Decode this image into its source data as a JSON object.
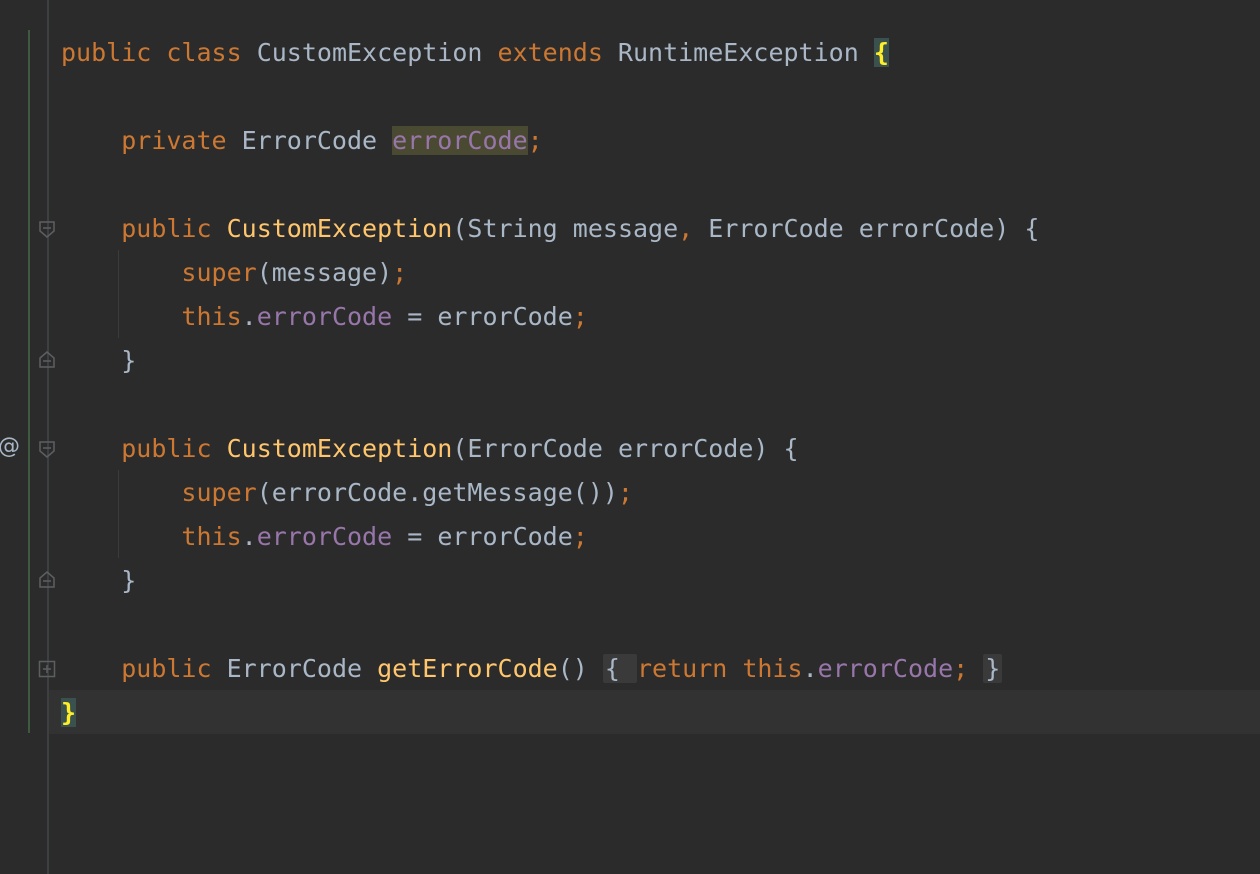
{
  "editor": {
    "gutter": {
      "override_marker": "@"
    },
    "lines": [
      [
        {
          "t": "public",
          "c": "kw"
        },
        {
          "t": " "
        },
        {
          "t": "class",
          "c": "kw"
        },
        {
          "t": " CustomException "
        },
        {
          "t": "extends",
          "c": "kw"
        },
        {
          "t": " RuntimeException "
        },
        {
          "t": "{",
          "c": "brace-match"
        }
      ],
      [],
      [
        {
          "t": "    "
        },
        {
          "t": "private",
          "c": "kw"
        },
        {
          "t": " ErrorCode "
        },
        {
          "t": "errorCode",
          "c": "fld field-highlight"
        },
        {
          "t": ";",
          "c": "kw"
        }
      ],
      [],
      [
        {
          "t": "    "
        },
        {
          "t": "public",
          "c": "kw"
        },
        {
          "t": " "
        },
        {
          "t": "CustomException",
          "c": "fn"
        },
        {
          "t": "(String message"
        },
        {
          "t": ",",
          "c": "kw"
        },
        {
          "t": " ErrorCode errorCode) {"
        }
      ],
      [
        {
          "t": "        "
        },
        {
          "t": "super",
          "c": "kw"
        },
        {
          "t": "(message)"
        },
        {
          "t": ";",
          "c": "kw"
        }
      ],
      [
        {
          "t": "        "
        },
        {
          "t": "this",
          "c": "kw"
        },
        {
          "t": "."
        },
        {
          "t": "errorCode",
          "c": "fld"
        },
        {
          "t": " = errorCode"
        },
        {
          "t": ";",
          "c": "kw"
        }
      ],
      [
        {
          "t": "    }"
        }
      ],
      [],
      [
        {
          "t": "    "
        },
        {
          "t": "public",
          "c": "kw"
        },
        {
          "t": " "
        },
        {
          "t": "CustomException",
          "c": "fn"
        },
        {
          "t": "(ErrorCode errorCode) {"
        }
      ],
      [
        {
          "t": "        "
        },
        {
          "t": "super",
          "c": "kw"
        },
        {
          "t": "(errorCode.getMessage())"
        },
        {
          "t": ";",
          "c": "kw"
        }
      ],
      [
        {
          "t": "        "
        },
        {
          "t": "this",
          "c": "kw"
        },
        {
          "t": "."
        },
        {
          "t": "errorCode",
          "c": "fld"
        },
        {
          "t": " = errorCode"
        },
        {
          "t": ";",
          "c": "kw"
        }
      ],
      [
        {
          "t": "    }"
        }
      ],
      [],
      [
        {
          "t": "    "
        },
        {
          "t": "public",
          "c": "kw"
        },
        {
          "t": " ErrorCode "
        },
        {
          "t": "getErrorCode",
          "c": "fn"
        },
        {
          "t": "() "
        },
        {
          "t": "{ ",
          "c": "fold-box"
        },
        {
          "t": "return",
          "c": "kw"
        },
        {
          "t": " "
        },
        {
          "t": "this",
          "c": "kw"
        },
        {
          "t": "."
        },
        {
          "t": "errorCode",
          "c": "fld"
        },
        {
          "t": ";",
          "c": "kw"
        },
        {
          "t": " "
        },
        {
          "t": "}",
          "c": "fold-box"
        }
      ],
      [
        {
          "t": "}",
          "c": "brace-match"
        }
      ]
    ],
    "colors": {
      "background": "#2b2b2b",
      "keyword": "#cc7832",
      "field": "#9876aa",
      "function": "#ffc66d",
      "text": "#a9b7c6",
      "brace_match": "#ffef28",
      "current_line": "#323232"
    },
    "fold_icons": [
      "fold-open-icon",
      "fold-close-icon",
      "fold-open-icon",
      "fold-close-icon",
      "folded-expand-icon"
    ]
  }
}
